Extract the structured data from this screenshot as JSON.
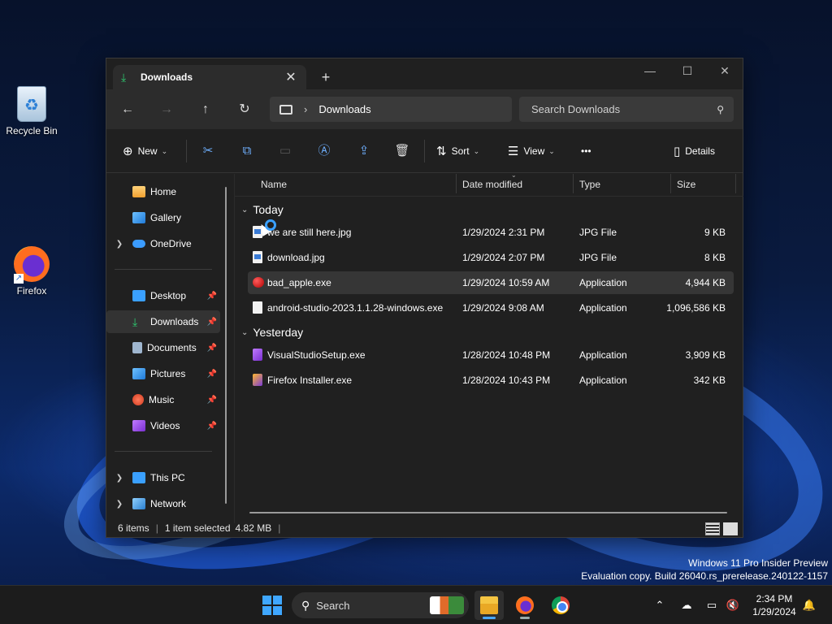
{
  "desktop": {
    "icons": [
      {
        "label": "Recycle Bin",
        "icon": "recycle-bin-icon"
      },
      {
        "label": "Firefox",
        "icon": "firefox-icon"
      }
    ],
    "watermark_line1": "Windows 11 Pro Insider Preview",
    "watermark_line2": "Evaluation copy. Build 26040.rs_prerelease.240122-1157"
  },
  "window": {
    "tab_label": "Downloads",
    "tab_icon": "download-icon",
    "new_tab": "+",
    "controls": {
      "minimize": "—",
      "maximize": "☐",
      "close": "✕"
    },
    "nav": {
      "back": "←",
      "forward": "→",
      "up": "↑",
      "refresh": "↻"
    },
    "address": {
      "separator": "›",
      "crumb": "Downloads"
    },
    "search_placeholder": "Search Downloads",
    "toolbar": {
      "new_label": "New",
      "sort_label": "Sort",
      "view_label": "View",
      "more": "•••",
      "details_label": "Details"
    },
    "sidebar": {
      "home": "Home",
      "gallery": "Gallery",
      "onedrive": "OneDrive",
      "desktop": "Desktop",
      "downloads": "Downloads",
      "documents": "Documents",
      "pictures": "Pictures",
      "music": "Music",
      "videos": "Videos",
      "this_pc": "This PC",
      "network": "Network"
    },
    "columns": {
      "name": "Name",
      "date": "Date modified",
      "type": "Type",
      "size": "Size"
    },
    "groups": {
      "today": {
        "label": "Today",
        "files": [
          {
            "name": "we are still here.jpg",
            "date": "1/29/2024 2:31 PM",
            "type": "JPG File",
            "size": "9 KB"
          },
          {
            "name": "download.jpg",
            "date": "1/29/2024 2:07 PM",
            "type": "JPG File",
            "size": "8 KB"
          },
          {
            "name": "bad_apple.exe",
            "date": "1/29/2024 10:59 AM",
            "type": "Application",
            "size": "4,944 KB"
          },
          {
            "name": "android-studio-2023.1.1.28-windows.exe",
            "date": "1/29/2024 9:08 AM",
            "type": "Application",
            "size": "1,096,586 KB"
          }
        ]
      },
      "yesterday": {
        "label": "Yesterday",
        "files": [
          {
            "name": "VisualStudioSetup.exe",
            "date": "1/28/2024 10:48 PM",
            "type": "Application",
            "size": "3,909 KB"
          },
          {
            "name": "Firefox Installer.exe",
            "date": "1/28/2024 10:43 PM",
            "type": "Application",
            "size": "342 KB"
          }
        ]
      }
    },
    "status": {
      "items": "6 items",
      "selected": "1 item selected",
      "size": "4.82 MB"
    }
  },
  "taskbar": {
    "search_placeholder": "Search",
    "time": "2:34 PM",
    "date": "1/29/2024",
    "apps": [
      "file-explorer",
      "firefox",
      "chrome"
    ]
  },
  "colors": {
    "accent": "#3fa7ff",
    "window_bg": "#202020",
    "download_green": "#2ec96f"
  }
}
